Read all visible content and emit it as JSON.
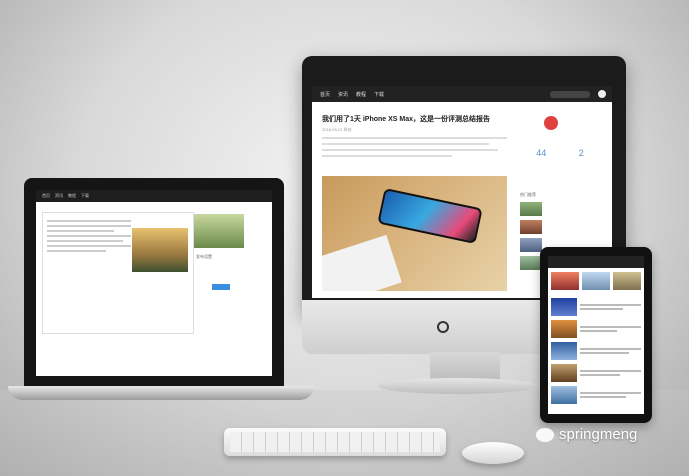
{
  "watermark": {
    "text": "springmeng",
    "icon": "wechat-icon"
  },
  "imac": {
    "nav_items": [
      "首页",
      "资讯",
      "教程",
      "下载"
    ],
    "article_title": "我们用了1天 iPhone XS Max，这是一份评测总结报告",
    "article_meta": "2018-09-21  科技",
    "stats": [
      "44",
      "2"
    ],
    "side_heading": "热门推荐"
  },
  "laptop": {
    "nav_items": [
      "首页",
      "资讯",
      "教程",
      "下载"
    ],
    "sidebar_label": "发布设置"
  },
  "tablet": {
    "list_count": 6
  },
  "colors": {
    "accent": "#3a8fe0",
    "dark": "#1b1b1b"
  }
}
